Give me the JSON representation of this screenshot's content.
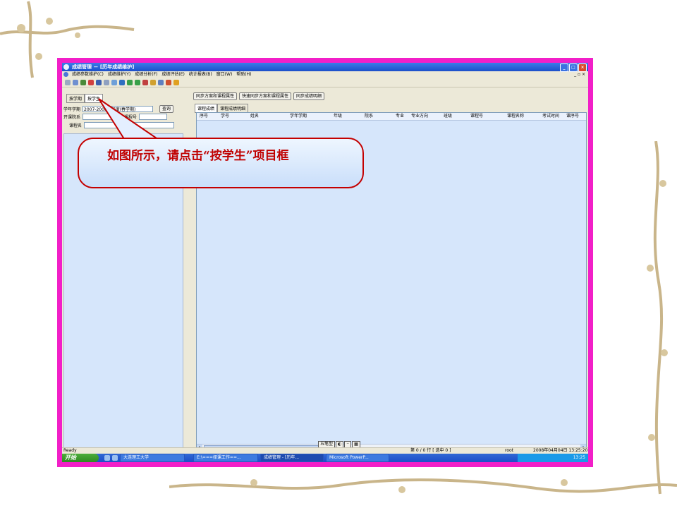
{
  "window": {
    "title": "成绩管理 － [历年成绩维护]"
  },
  "menu": {
    "items": [
      "成绩参数维护(C)",
      "成绩维护(Y)",
      "成绩分析(F)",
      "成绩评估(E)",
      "统计报表(B)",
      "窗口(W)",
      "帮助(H)"
    ],
    "mdi_controls": "_ ▫ ×"
  },
  "left": {
    "tabs": [
      "按学期",
      "按学生"
    ],
    "semester_label": "学年学期",
    "semester_value": "2007-2008学年度(春学期)",
    "query_button": "查询",
    "dept_label": "开课院系",
    "course_label": "课程名",
    "course_no_label": "课程号"
  },
  "right": {
    "buttons": [
      "同步方案和课程属性",
      "快速同步方案和课程属性",
      "同步成绩明细"
    ],
    "subtabs": [
      "课程成绩",
      "课程成绩明细"
    ],
    "columns": [
      "序号",
      "学号",
      "姓名",
      "学年学期",
      "年级",
      "院系",
      "专业",
      "专业方向",
      "班级",
      "课程号",
      "课程名称",
      "考试时间",
      "课序号"
    ]
  },
  "status": {
    "ready": "Ready",
    "rows": "第 0 / 0 行 [ 选中 0 ]",
    "user": "root",
    "datetime": "2008年04月04日 13:25:20"
  },
  "ime": [
    "五笔型",
    "◐",
    "··",
    "▦"
  ],
  "taskbar": {
    "start": "开始",
    "tasks": [
      "大连理工大学",
      "E:\\===择课工作==...",
      "成绩管理 - [历年...",
      "Microsoft PowerP..."
    ],
    "clock": "13:25"
  },
  "callout": {
    "text": "如图所示，请点击“按学生”项目框"
  }
}
